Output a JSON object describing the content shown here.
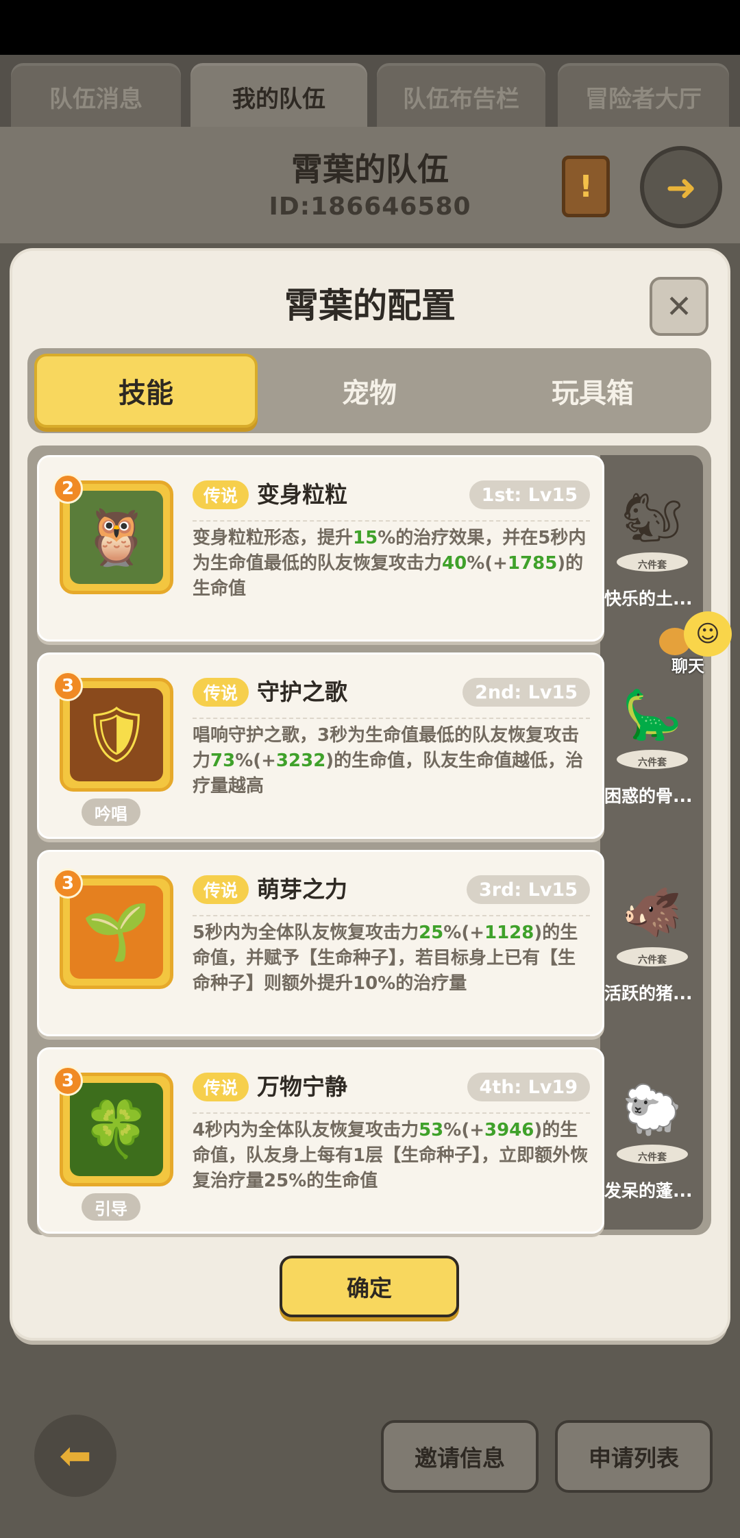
{
  "top_tabs": [
    "队伍消息",
    "我的队伍",
    "队伍布告栏",
    "冒险者大厅"
  ],
  "team": {
    "name": "霄葉的队伍",
    "id_text": "ID:186646580"
  },
  "modal": {
    "title": "霄葉的配置",
    "tabs": [
      "技能",
      "宠物",
      "玩具箱"
    ],
    "confirm_label": "确定"
  },
  "skills": [
    {
      "level_badge": "2",
      "rarity": "传说",
      "name": "变身粒粒",
      "slot_level": "1st: Lv15",
      "tag": "",
      "desc_parts": [
        "变身粒粒形态，提升",
        "15",
        "%的治疗效果，并在5秒内为生命值最低的队友恢复攻击力",
        "40",
        "%(+",
        "1785",
        ")的生命值"
      ]
    },
    {
      "level_badge": "3",
      "rarity": "传说",
      "name": "守护之歌",
      "slot_level": "2nd: Lv15",
      "tag": "吟唱",
      "desc_parts": [
        "唱响守护之歌，3秒为生命值最低的队友恢复攻击力",
        "73",
        "%(+",
        "3232",
        ")的生命值，队友生命值越低，治疗量越高"
      ]
    },
    {
      "level_badge": "3",
      "rarity": "传说",
      "name": "萌芽之力",
      "slot_level": "3rd: Lv15",
      "tag": "",
      "desc_parts": [
        "5秒内为全体队友恢复攻击力",
        "25",
        "%(+",
        "1128",
        ")的生命值，并赋予【生命种子】，若目标身上已有【生命种子】则额外提升10%的治疗量"
      ]
    },
    {
      "level_badge": "3",
      "rarity": "传说",
      "name": "万物宁静",
      "slot_level": "4th: Lv19",
      "tag": "引导",
      "desc_parts": [
        "4秒内为全体队友恢复攻击力",
        "53",
        "%(+",
        "3946",
        ")的生命值，队友身上每有1层【生命种子】，立即额外恢复治疗量25%的生命值"
      ]
    }
  ],
  "pets": [
    {
      "name": "快乐的土...",
      "set_label": "六件套"
    },
    {
      "name": "困惑的骨...",
      "set_label": "六件套"
    },
    {
      "name": "活跃的猪...",
      "set_label": "六件套"
    },
    {
      "name": "发呆的蓬...",
      "set_label": "六件套"
    }
  ],
  "chat_label": "聊天",
  "bottom": {
    "invite_label": "邀请信息",
    "apply_label": "申请列表"
  },
  "colors": {
    "accent": "#f8d75e",
    "highlight": "#3fa12a",
    "rarity": "#f6cf4c"
  }
}
